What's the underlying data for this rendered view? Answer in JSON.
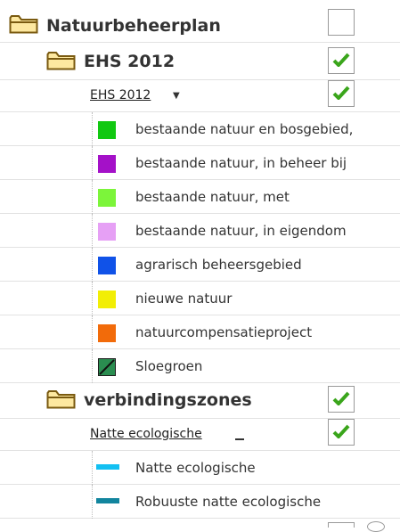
{
  "colors": {
    "check": "#3aa51b",
    "folder_fill": "#fde8a0",
    "folder_stroke": "#7a5a10",
    "row_border": "#e2e2e2"
  },
  "tree": {
    "root": {
      "label": "Natuurbeheerplan",
      "icon": "folder-icon",
      "checked": false
    },
    "ehs": {
      "label": "EHS 2012",
      "icon": "folder-icon",
      "checked": true,
      "layer": {
        "label": "EHS 2012",
        "checked": true,
        "dropdown_icon": "caret-down-icon"
      },
      "legend": [
        {
          "label": "bestaande natuur en bosgebied,",
          "color": "#11c811"
        },
        {
          "label": "bestaande natuur, in beheer bij",
          "color": "#a411c8"
        },
        {
          "label": "bestaande natuur, met",
          "color": "#7cf53a"
        },
        {
          "label": "bestaande natuur, in eigendom",
          "color": "#e6a0f5"
        },
        {
          "label": "agrarisch beheersgebied",
          "color": "#1052e8"
        },
        {
          "label": "nieuwe natuur",
          "color": "#f2ee05"
        },
        {
          "label": "natuurcompensatieproject",
          "color": "#f26b0a"
        },
        {
          "label": "Sloegroen",
          "color": "#2a8d50",
          "hatched": true
        }
      ]
    },
    "verbinding": {
      "label": "verbindingszones",
      "icon": "folder-icon",
      "checked": true,
      "layer": {
        "label": "Natte ecologische",
        "checked": true
      },
      "legend": [
        {
          "label": "Natte ecologische",
          "color": "#13c0f2"
        },
        {
          "label": "Robuuste natte ecologische",
          "color": "#12859e"
        }
      ]
    }
  }
}
